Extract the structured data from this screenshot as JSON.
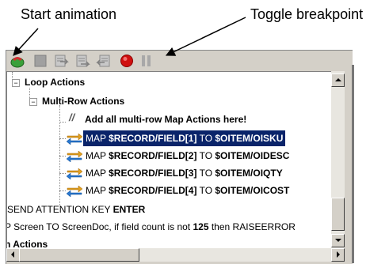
{
  "callouts": {
    "start_animation": "Start animation",
    "toggle_breakpoint": "Toggle breakpoint"
  },
  "toolbar": {
    "buttons": [
      {
        "name": "start-animation-button",
        "icon": "animation-icon",
        "color": "#3aa03a"
      },
      {
        "name": "stop-button",
        "icon": "stop-square-icon",
        "color": "#9a9a9a"
      },
      {
        "name": "step-into-button",
        "icon": "step-into-icon",
        "color": "#8a8a8a"
      },
      {
        "name": "step-over-button",
        "icon": "step-over-icon",
        "color": "#8a8a8a"
      },
      {
        "name": "step-out-button",
        "icon": "step-out-icon",
        "color": "#8a8a8a"
      },
      {
        "name": "toggle-breakpoint-button",
        "icon": "breakpoint-red-dot-icon",
        "color": "#d01010"
      },
      {
        "name": "pause-button",
        "icon": "pause-icon",
        "color": "#9a9a9a"
      }
    ]
  },
  "tree": {
    "loop_actions": "Loop Actions",
    "multi_row_actions": "Multi-Row Actions",
    "comment": "Add all multi-row Map Actions here!",
    "map_rows": [
      {
        "prefix": "MAP ",
        "field": "$RECORD/FIELD[1]",
        "to": " TO ",
        "target": "$OITEM/OISKU",
        "selected": true
      },
      {
        "prefix": "MAP ",
        "field": "$RECORD/FIELD[2]",
        "to": " TO ",
        "target": "$OITEM/OIDESC",
        "selected": false
      },
      {
        "prefix": "MAP ",
        "field": "$RECORD/FIELD[3]",
        "to": " TO ",
        "target": "$OITEM/OIQTY",
        "selected": false
      },
      {
        "prefix": "MAP ",
        "field": "$RECORD/FIELD[4]",
        "to": " TO ",
        "target": "$OITEM/OICOST",
        "selected": false
      }
    ],
    "send_attention_prefix": "SEND ATTENTION KEY ",
    "send_attention_key": "ENTER",
    "screen_line_prefix": "P Screen TO ScreenDoc, if field count is not ",
    "screen_line_count": "125",
    "screen_line_suffix": " then RAISEERROR",
    "partial_last": "n Actions"
  },
  "colors": {
    "selection_bg": "#0a246a",
    "frame": "#d4d0c8"
  }
}
